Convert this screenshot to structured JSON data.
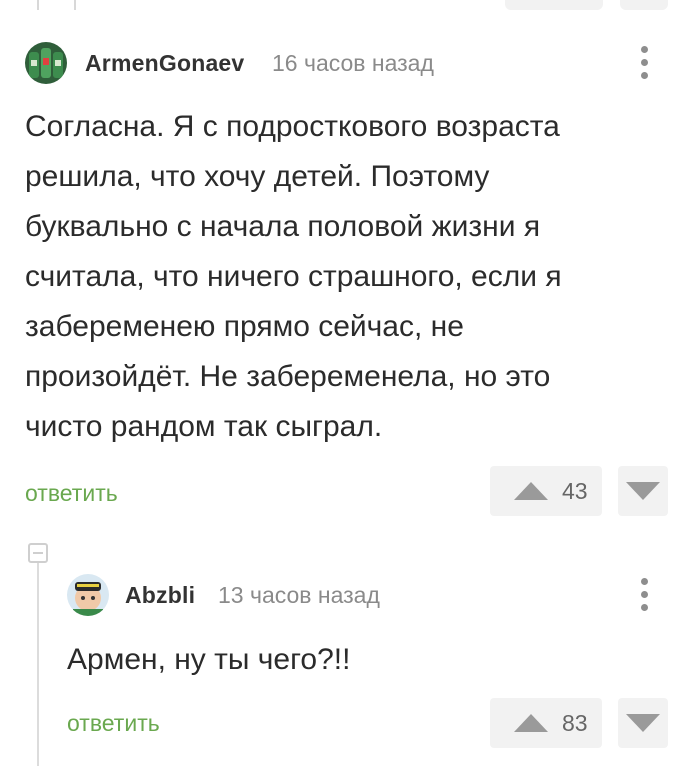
{
  "comments": [
    {
      "username": "ArmenGonaev",
      "time": "16 часов назад",
      "text_lines": [
        "Согласна. Я с подросткового возраста",
        "решила, что хочу детей. Поэтому",
        "буквально с начала половой жизни я",
        "считала, что ничего страшного, если я",
        "забеременею прямо сейчас, не",
        "произойдёт. Не забеременела, но это",
        "чисто рандом так сыграл."
      ],
      "reply_label": "ответить",
      "rating": "43"
    },
    {
      "username": "Abzbli",
      "time": "13 часов назад",
      "text_lines": [
        "Армен, ну ты чего?!!"
      ],
      "reply_label": "ответить",
      "rating": "83"
    }
  ],
  "colors": {
    "reply_link": "#6aa84f",
    "vote_bg": "#f2f2f2",
    "vote_arrow": "#9a9a9a",
    "thread_line": "#dcdcdc"
  },
  "icons": [
    "avatar-armen",
    "avatar-abzbli",
    "more-vertical-icon",
    "arrow-up-icon",
    "arrow-down-icon",
    "collapse-minus-icon"
  ]
}
